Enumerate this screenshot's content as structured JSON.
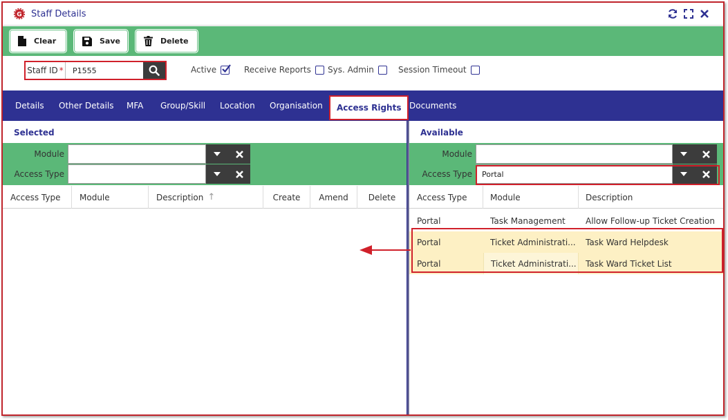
{
  "window": {
    "title": "Staff Details",
    "actions": [
      "refresh-icon",
      "expand-icon",
      "close-icon"
    ]
  },
  "toolbar": {
    "clear_label": "Clear",
    "save_label": "Save",
    "delete_label": "Delete"
  },
  "staff": {
    "id_label": "Staff ID",
    "required_mark": "*",
    "id_value": "P1555",
    "active_label": "Active",
    "active_checked": true,
    "receive_reports_label": "Receive Reports",
    "receive_reports_checked": false,
    "sys_admin_label": "Sys. Admin",
    "sys_admin_checked": false,
    "session_timeout_label": "Session Timeout",
    "session_timeout_checked": false
  },
  "tabs": [
    {
      "label": "Details"
    },
    {
      "label": "Other Details"
    },
    {
      "label": "MFA"
    },
    {
      "label": "Group/Skill"
    },
    {
      "label": "Location"
    },
    {
      "label": "Organisation"
    },
    {
      "label": "Access Rights",
      "active": true
    },
    {
      "label": "Documents"
    }
  ],
  "selected": {
    "title": "Selected",
    "module_label": "Module",
    "module_value": "",
    "access_type_label": "Access Type",
    "access_type_value": "",
    "columns": [
      "Access Type",
      "Module",
      "Description",
      "Create",
      "Amend",
      "Delete"
    ],
    "sort_indicator": "↑",
    "rows": []
  },
  "available": {
    "title": "Available",
    "module_label": "Module",
    "module_value": "",
    "access_type_label": "Access Type",
    "access_type_value": "Portal",
    "columns": [
      "Access Type",
      "Module",
      "Description"
    ],
    "rows": [
      {
        "access_type": "Portal",
        "module": "Task Management",
        "description": "Allow Follow-up Ticket Creation",
        "selected": false
      },
      {
        "access_type": "Portal",
        "module": "Ticket Administrati...",
        "description": "Task Ward Helpdesk",
        "selected": true
      },
      {
        "access_type": "Portal",
        "module": "Ticket Administrati...",
        "description": "Task Ward Ticket List",
        "selected": true
      }
    ]
  },
  "colors": {
    "brand_blue": "#2e3192",
    "toolbar_green": "#5bb878",
    "highlight_red": "#d0202a",
    "selected_row": "#fdf0c4",
    "dark_button": "#3c3c3c"
  }
}
